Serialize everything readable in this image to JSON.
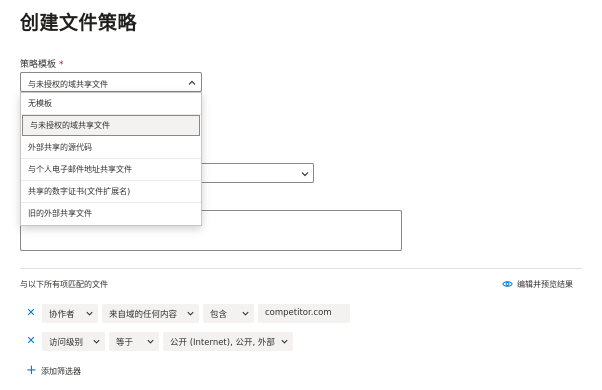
{
  "page": {
    "title": "创建文件策略"
  },
  "template": {
    "label": "策略模板",
    "required_mark": "*",
    "selected_value": "与未授权的域共享文件",
    "options": [
      "无模板",
      "与未授权的域共享文件",
      "外部共享的源代码",
      "与个人电子邮件地址共享文件",
      "共享的数字证书(文件扩展名)",
      "旧的外部共享文件"
    ]
  },
  "filters": {
    "section_label": "与以下所有项匹配的文件",
    "preview_link": "编辑并预览结果",
    "rows": [
      {
        "field": "协作者",
        "operator": "来自域的任何内容",
        "condition": "包含",
        "value": "competitor.com"
      },
      {
        "field": "访问级别",
        "operator": "等于",
        "value": "公开 (Internet), 公开, 外部"
      }
    ],
    "add_filter": "添加筛选器"
  },
  "icons": {
    "close": "close-icon",
    "chevron": "chevron-down-icon",
    "eye": "eye-icon",
    "add": "add-icon"
  },
  "colors": {
    "accent": "#0078d4",
    "text": "#323130",
    "pill_bg": "#f3f2f1",
    "required": "#a4262c"
  }
}
